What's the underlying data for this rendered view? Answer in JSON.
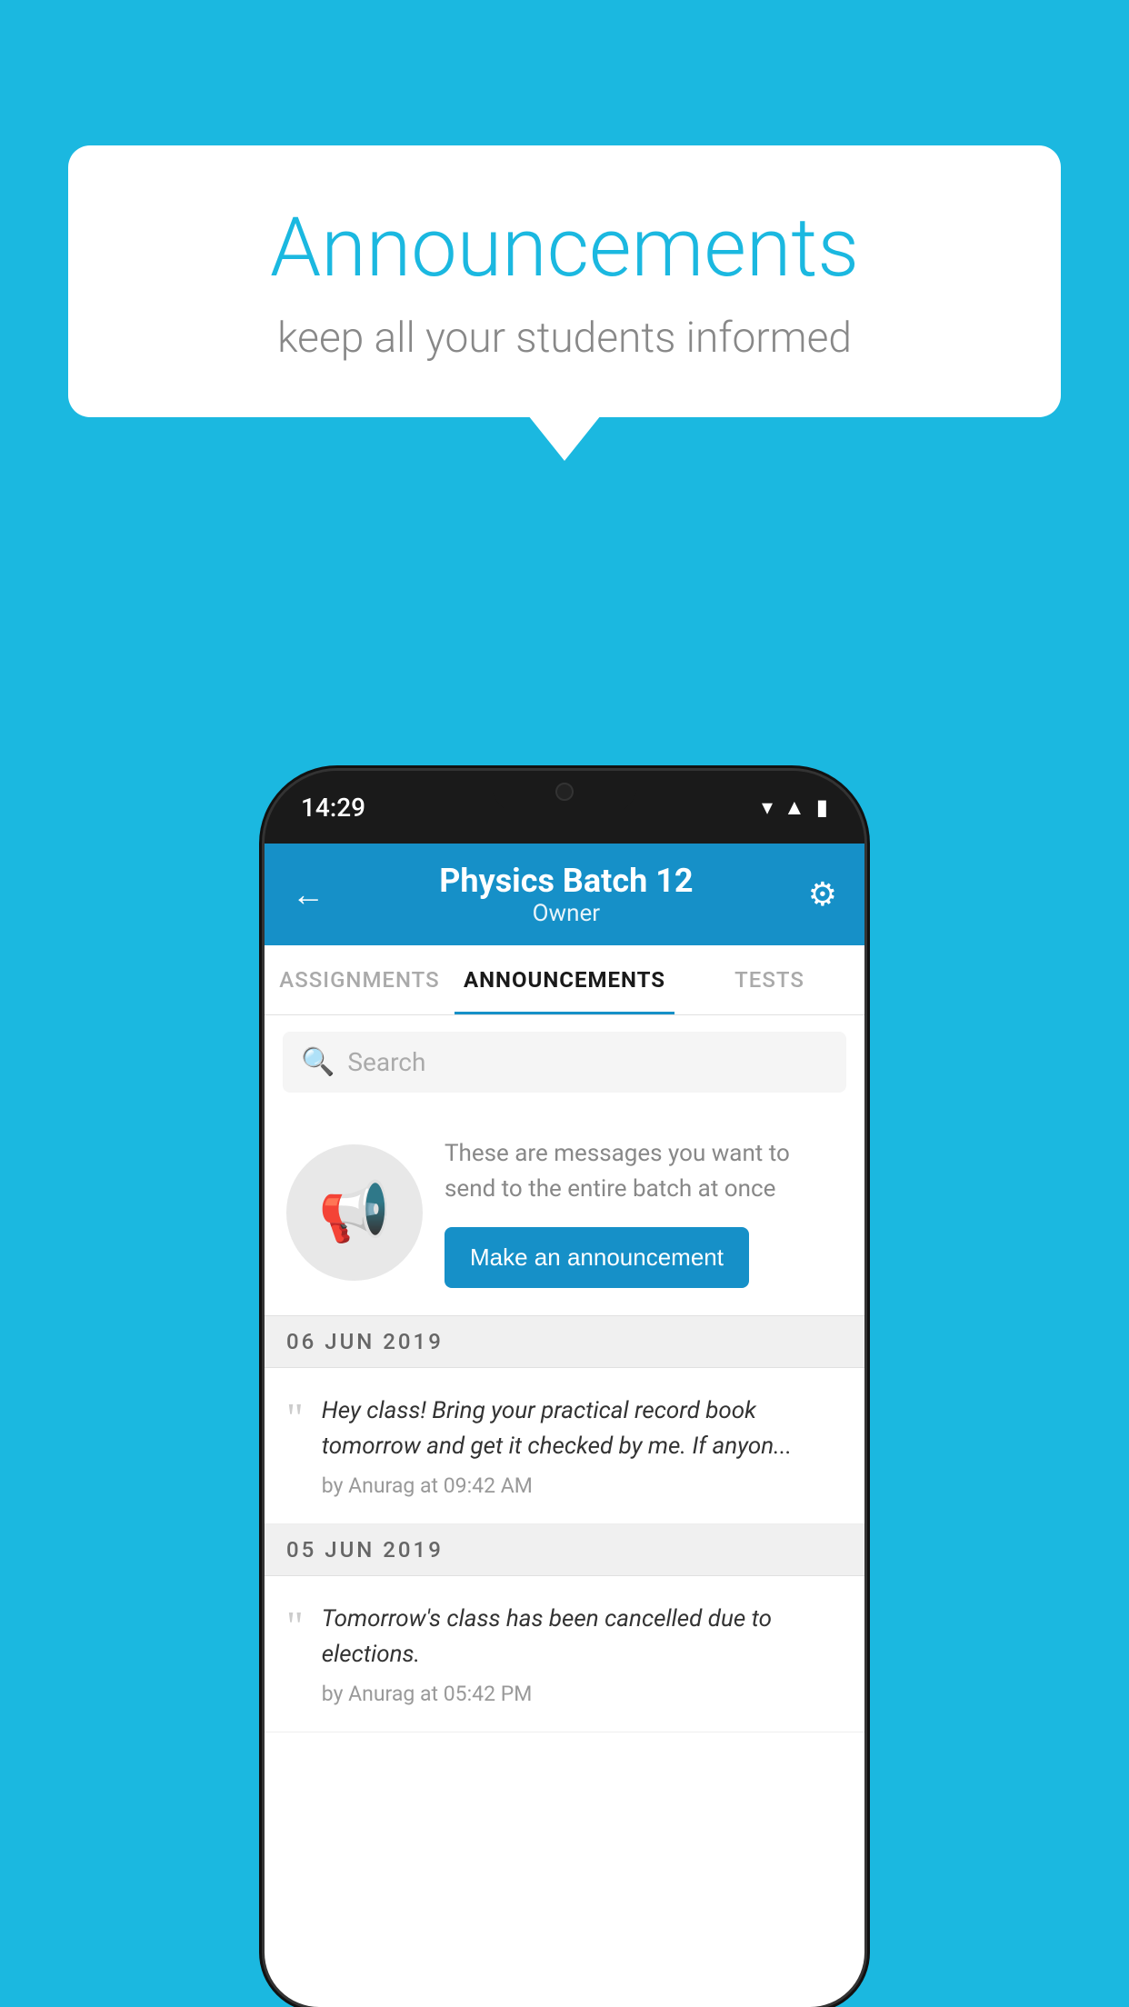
{
  "background_color": "#1BB8E0",
  "speech_bubble": {
    "title": "Announcements",
    "subtitle": "keep all your students informed"
  },
  "phone": {
    "status_bar": {
      "time": "14:29",
      "icons": [
        "wifi",
        "signal",
        "battery"
      ]
    },
    "header": {
      "back_label": "←",
      "title": "Physics Batch 12",
      "subtitle": "Owner",
      "gear_label": "⚙"
    },
    "tabs": [
      {
        "label": "ASSIGNMENTS",
        "active": false
      },
      {
        "label": "ANNOUNCEMENTS",
        "active": true
      },
      {
        "label": "TESTS",
        "active": false
      },
      {
        "label": "...",
        "active": false
      }
    ],
    "search": {
      "placeholder": "Search"
    },
    "promo": {
      "description": "These are messages you want to send to the entire batch at once",
      "button_label": "Make an announcement"
    },
    "announcements": [
      {
        "date": "06  JUN  2019",
        "items": [
          {
            "text": "Hey class! Bring your practical record book tomorrow and get it checked by me. If anyon...",
            "meta": "by Anurag at 09:42 AM"
          }
        ]
      },
      {
        "date": "05  JUN  2019",
        "items": [
          {
            "text": "Tomorrow's class has been cancelled due to elections.",
            "meta": "by Anurag at 05:42 PM"
          }
        ]
      }
    ]
  }
}
